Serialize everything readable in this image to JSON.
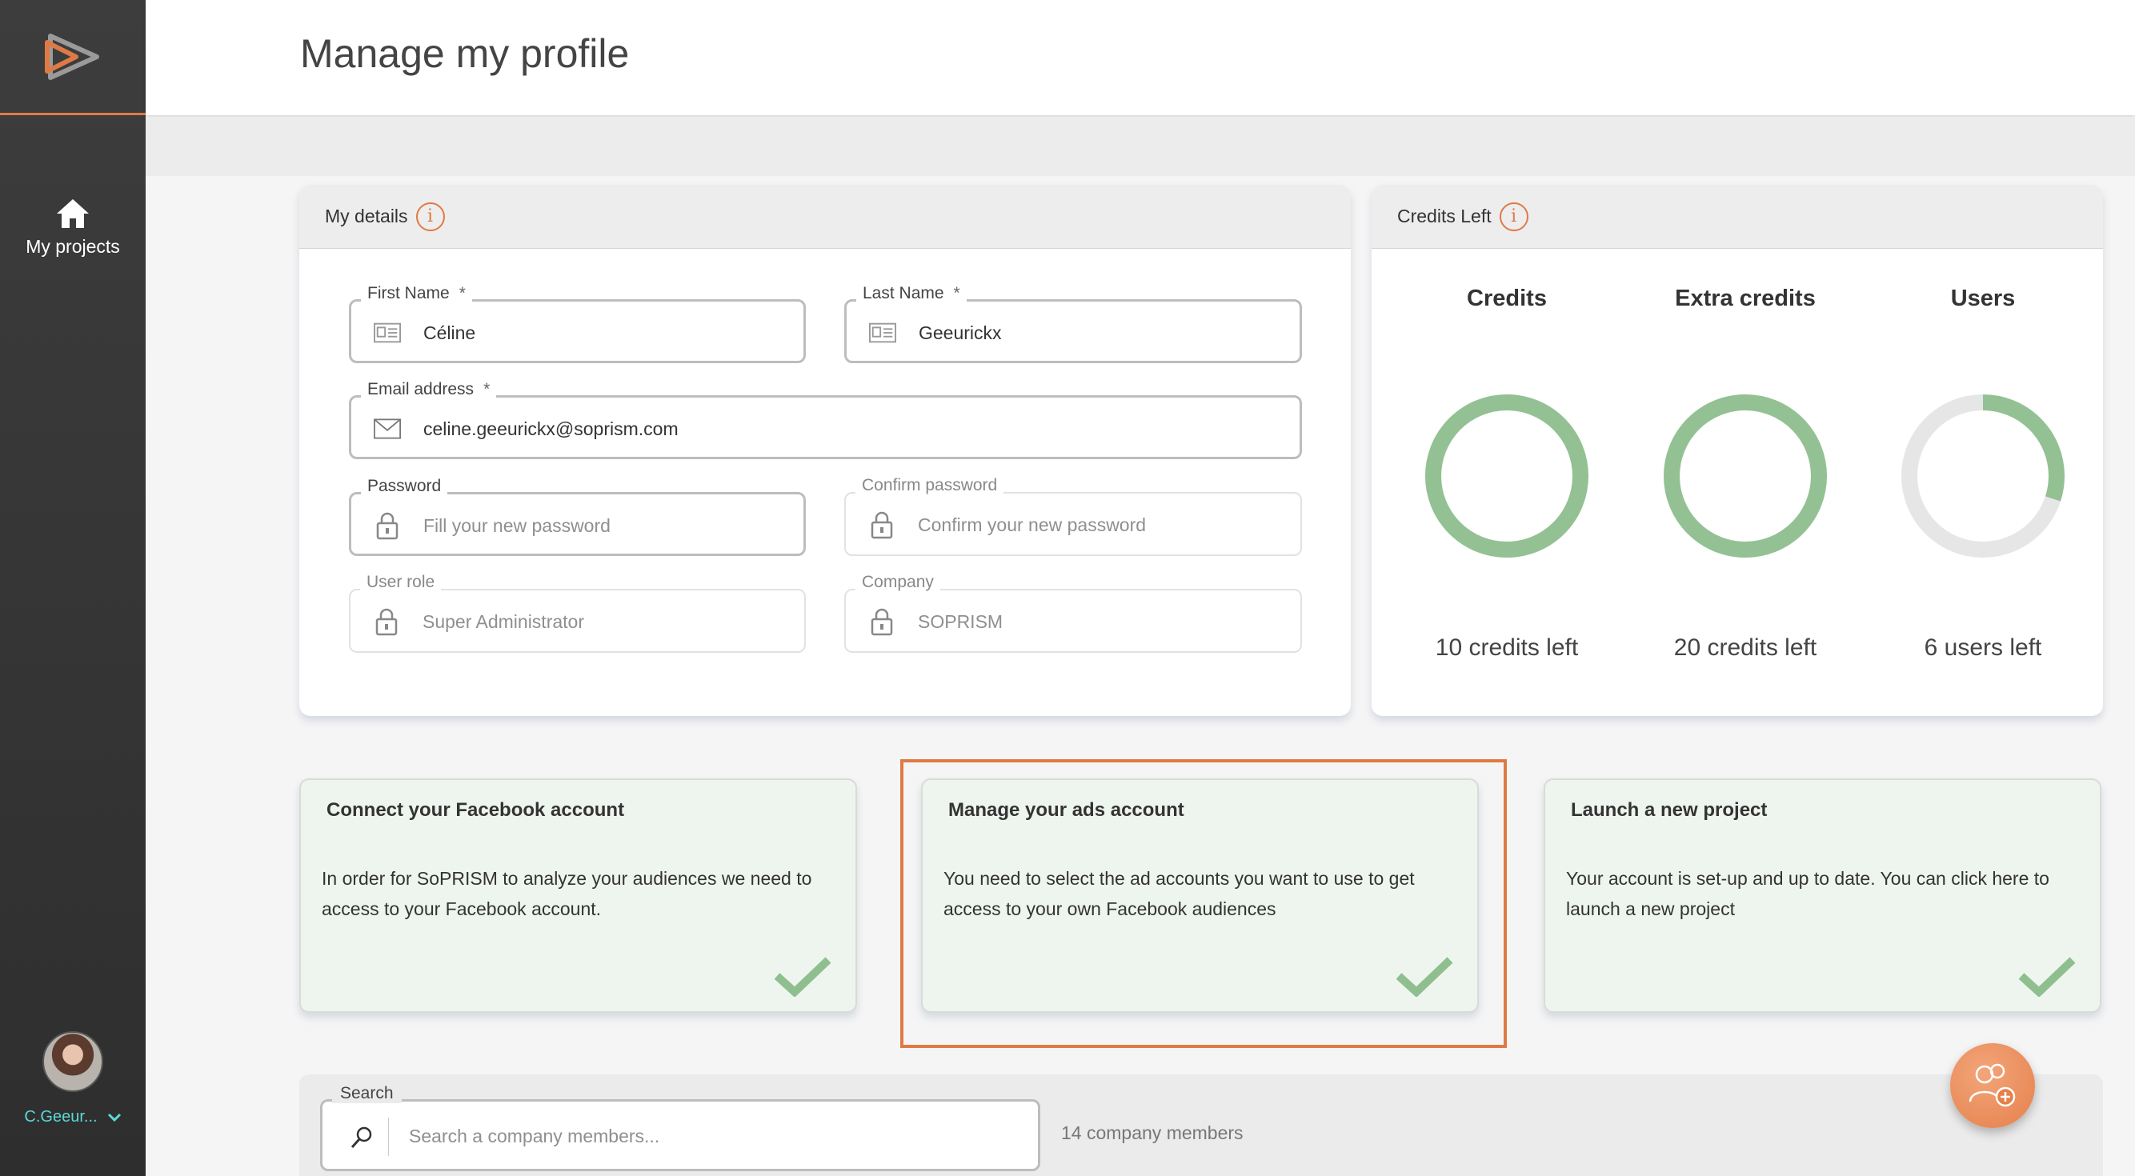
{
  "header": {
    "title": "Manage my profile"
  },
  "sidebar": {
    "nav": {
      "my_projects": "My projects"
    },
    "user": {
      "name": "C.Geeur..."
    }
  },
  "details": {
    "title": "My details",
    "info_glyph": "i",
    "required_mark": "*",
    "first_name": {
      "label": "First Name",
      "value": "Céline"
    },
    "last_name": {
      "label": "Last Name",
      "value": "Geeurickx"
    },
    "email": {
      "label": "Email address",
      "value": "celine.geeurickx@soprism.com"
    },
    "password": {
      "label": "Password",
      "placeholder": "Fill your new password"
    },
    "confirm_password": {
      "label": "Confirm password",
      "placeholder": "Confirm your new password"
    },
    "user_role": {
      "label": "User role",
      "value": "Super Administrator"
    },
    "company": {
      "label": "Company",
      "value": "SOPRISM"
    }
  },
  "credits": {
    "title": "Credits Left",
    "info_glyph": "i",
    "items": [
      {
        "title": "Credits",
        "footer": "10 credits left",
        "fill": 1.0
      },
      {
        "title": "Extra credits",
        "footer": "20 credits left",
        "fill": 1.0
      },
      {
        "title": "Users",
        "footer": "6 users left",
        "fill": 0.3
      }
    ],
    "ring_color": "#93c193",
    "ring_track_color": "#e6e6e6"
  },
  "steps": [
    {
      "title": "Connect your Facebook account",
      "text": "In order for SoPRISM to analyze your audiences we need to access to your Facebook account."
    },
    {
      "title": "Manage your ads account",
      "text": "You need to select the ad accounts you want to use to get access to your own Facebook audiences"
    },
    {
      "title": "Launch a new project",
      "text": "Your account is set-up and up to date. You can click here to launch a new project"
    }
  ],
  "members": {
    "search_label": "Search",
    "search_placeholder": "Search a company members...",
    "count_text": "14 company members"
  },
  "colors": {
    "accent": "#e07a45",
    "check": "#8fbf8f",
    "step_bg": "#eef5ee"
  }
}
